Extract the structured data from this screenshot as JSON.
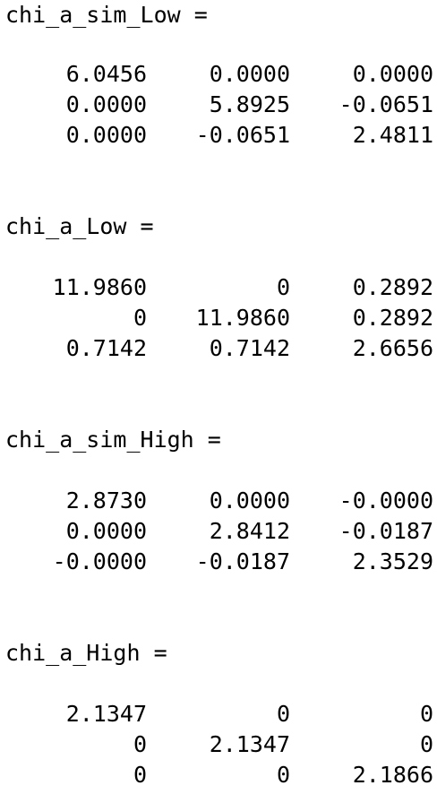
{
  "matrices": [
    {
      "title": "chi_a_sim_Low =",
      "rows": [
        [
          "6.0456",
          "0.0000",
          "0.0000"
        ],
        [
          "0.0000",
          "5.8925",
          "-0.0651"
        ],
        [
          "0.0000",
          "-0.0651",
          "2.4811"
        ]
      ]
    },
    {
      "title": "chi_a_Low =",
      "rows": [
        [
          "11.9860",
          "0",
          "0.2892"
        ],
        [
          "0",
          "11.9860",
          "0.2892"
        ],
        [
          "0.7142",
          "0.7142",
          "2.6656"
        ]
      ]
    },
    {
      "title": "chi_a_sim_High =",
      "rows": [
        [
          "2.8730",
          "0.0000",
          "-0.0000"
        ],
        [
          "0.0000",
          "2.8412",
          "-0.0187"
        ],
        [
          "-0.0000",
          "-0.0187",
          "2.3529"
        ]
      ]
    },
    {
      "title": "chi_a_High =",
      "rows": [
        [
          "2.1347",
          "0",
          "0"
        ],
        [
          "0",
          "2.1347",
          "0"
        ],
        [
          "0",
          "0",
          "2.1866"
        ]
      ]
    }
  ]
}
